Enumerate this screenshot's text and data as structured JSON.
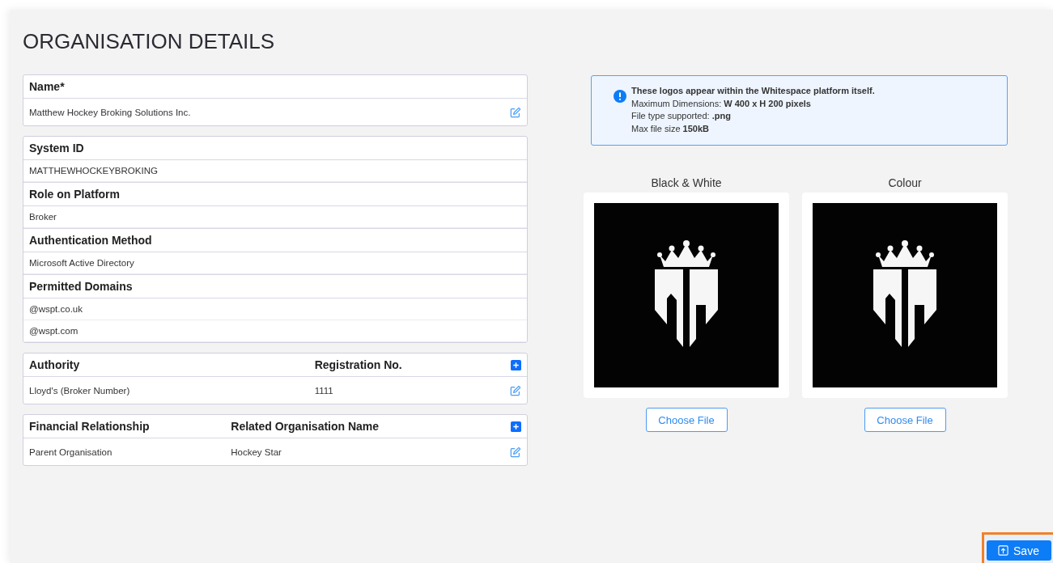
{
  "page_title": "ORGANISATION DETAILS",
  "name_card": {
    "label": "Name*",
    "value": "Matthew Hockey Broking Solutions Inc."
  },
  "details": [
    {
      "label": "System ID",
      "values": [
        "MATTHEWHOCKEYBROKING"
      ]
    },
    {
      "label": "Role on Platform",
      "values": [
        "Broker"
      ]
    },
    {
      "label": "Authentication Method",
      "values": [
        "Microsoft Active Directory"
      ]
    },
    {
      "label": "Permitted Domains",
      "values": [
        "@wspt.co.uk",
        "@wspt.com"
      ]
    }
  ],
  "tables": [
    {
      "columns": [
        "Authority",
        "Registration No."
      ],
      "rows": [
        [
          "Lloyd's (Broker Number)",
          "1111"
        ]
      ]
    },
    {
      "columns": [
        "Financial Relationship",
        "Related Organisation Name"
      ],
      "rows": [
        [
          "Parent Organisation",
          "Hockey Star"
        ]
      ]
    }
  ],
  "info": {
    "heading": "These logos appear within the Whitespace platform itself.",
    "lines": [
      "Maximum Dimensions: **W 400 x H 200 pixels**",
      "File type supported: **.png**",
      "Max file size **150kB**"
    ]
  },
  "logos": [
    {
      "label": "Black & White",
      "button": "Choose File"
    },
    {
      "label": "Colour",
      "button": "Choose File"
    }
  ],
  "save_button": "Save"
}
